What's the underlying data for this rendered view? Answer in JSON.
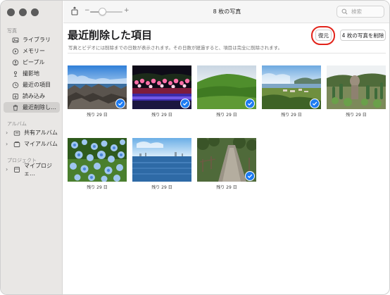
{
  "toolbar": {
    "title": "8 枚の写真",
    "zoom_minus": "−",
    "zoom_plus": "+",
    "zoom_level": 0.38,
    "search_placeholder": "検索"
  },
  "sidebar": {
    "sections": {
      "library": "写真",
      "albums": "アルバム",
      "projects": "プロジェクト"
    },
    "library_items": [
      {
        "label": "ライブラリ",
        "icon": "photos-library-icon"
      },
      {
        "label": "メモリー",
        "icon": "memories-icon"
      },
      {
        "label": "ピープル",
        "icon": "people-icon"
      },
      {
        "label": "撮影地",
        "icon": "places-pin-icon"
      },
      {
        "label": "最近の項目",
        "icon": "recents-clock-icon"
      },
      {
        "label": "読み込み",
        "icon": "imports-icon"
      },
      {
        "label": "最近削除し…",
        "icon": "trash-icon",
        "selected": true
      }
    ],
    "album_items": [
      {
        "label": "共有アルバム",
        "icon": "shared-album-icon"
      },
      {
        "label": "マイアルバム",
        "icon": "my-albums-icon"
      }
    ],
    "project_items": [
      {
        "label": "マイプロジェ…",
        "icon": "projects-icon"
      }
    ]
  },
  "main": {
    "title": "最近削除した項目",
    "description": "写真とビデオには削除までの日数が表示されます。その日数が経過すると、項目は完全に削除されます。",
    "restore_button": "復元",
    "delete_button": "4 枚の写真を削除",
    "highlight_color": "#e2231a"
  },
  "photos": [
    {
      "caption": "残り 29 日",
      "selected": true,
      "subject": "rocky coastline"
    },
    {
      "caption": "残り 29 日",
      "selected": true,
      "subject": "illuminated flower garden at night"
    },
    {
      "caption": "残り 29 日",
      "selected": true,
      "subject": "green hill"
    },
    {
      "caption": "残り 29 日",
      "selected": true,
      "subject": "coastal town view"
    },
    {
      "caption": "残り 29 日",
      "selected": false,
      "subject": "cactus garden with statue"
    },
    {
      "caption": "残り 29 日",
      "selected": false,
      "subject": "blue nemophila flowers"
    },
    {
      "caption": "残り 29 日",
      "selected": false,
      "subject": "lake"
    },
    {
      "caption": "残り 29 日",
      "selected": true,
      "subject": "garden path"
    }
  ],
  "colors": {
    "accent": "#1e7cf2",
    "sidebar_bg": "#e9e7e5",
    "selected_row": "#d2d0ce"
  }
}
